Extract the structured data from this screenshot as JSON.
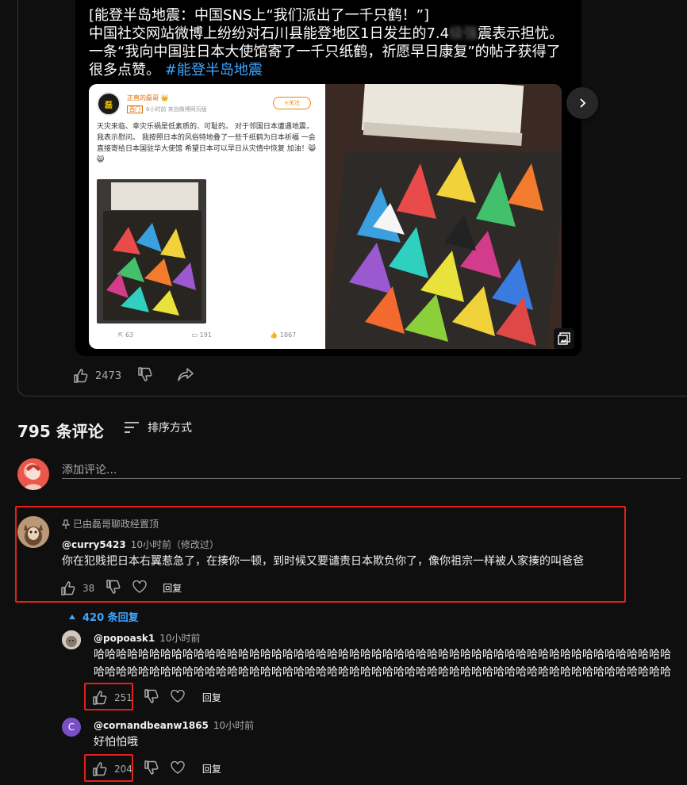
{
  "post": {
    "line1": "[能登半岛地震：中国SNS上“我们派出了一千只鹤！”]",
    "line2a": "中国社交网站微博上纷纷对石川县能登地区1日发生的7.4",
    "line2blur": "级强",
    "line2b": "震表示担忧。",
    "line3": "一条“我向中国驻日本大使馆寄了一千只纸鹤，祈愿早日康复”的帖子获得了",
    "line4": "很多点赞。",
    "hashtag": "#能登半岛地震",
    "likes": "2473",
    "embedded": {
      "name": "正直的磊哥",
      "badge": "西门",
      "meta": "6小时前  来自微博网页版",
      "follow": "+关注",
      "body": "天灾来临、幸灾乐祸是低素质的、可耻的。 对于邻国日本遭遇地震，我表示慰问。 我按照日本的风俗特地叠了一些千纸鹤为日本祈福 一会直接寄给日本国驻华大使馆 希望日本可以早日从灾情中恢复 加油！😸😸",
      "reposts": "63",
      "comments": "191",
      "likes": "1867"
    }
  },
  "comments_header": {
    "count": "795 条评论",
    "sort": "排序方式"
  },
  "add_comment": {
    "placeholder": "添加评论..."
  },
  "comments": [
    {
      "pinned": "已由磊哥聊政经置顶",
      "author": "@curry5423",
      "time": "10小时前（修改过）",
      "text": "你在犯贱把日本右翼惹急了，在揍你一顿，到时候又要谴责日本欺负你了，像你祖宗一样被人家揍的叫爸爸",
      "likes": "38",
      "reply": "回复",
      "replies_toggle": "420 条回复"
    }
  ],
  "replies": [
    {
      "author": "@popoask1",
      "time": "10小时前",
      "text": "哈哈哈哈哈哈哈哈哈哈哈哈哈哈哈哈哈哈哈哈哈哈哈哈哈哈哈哈哈哈哈哈哈哈哈哈哈哈哈哈哈哈哈哈哈哈哈哈哈哈哈哈哈哈哈哈哈哈哈哈哈哈哈哈哈哈哈哈哈哈哈哈哈哈哈哈哈哈哈哈哈哈哈哈哈哈哈哈哈哈哈哈哈哈哈哈哈哈哈哈哈哈哈哈哈哈哈哈哈哈哈哈哈哈哈",
      "likes": "251",
      "reply": "回复"
    },
    {
      "avatar_letter": "C",
      "author": "@cornandbeanw1865",
      "time": "10小时前",
      "text": "好怕怕哦",
      "likes": "204",
      "reply": "回复"
    }
  ],
  "colors": {
    "highlight": "#e3211b",
    "link": "#3ea6ff",
    "background": "#0f0f0f"
  }
}
